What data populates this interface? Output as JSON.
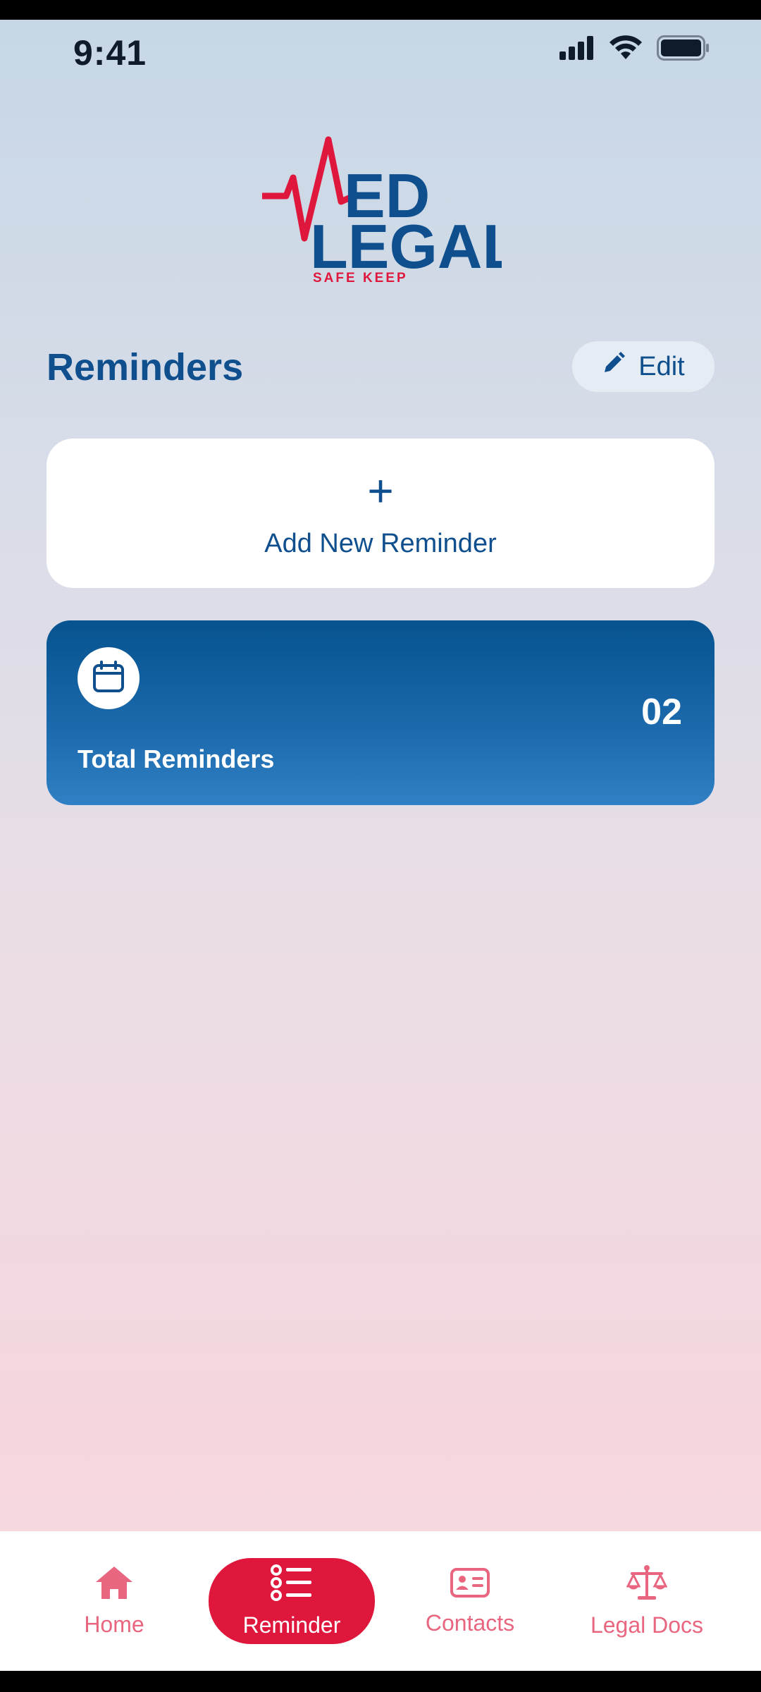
{
  "status_bar": {
    "time": "9:41"
  },
  "logo": {
    "line1": "ED",
    "line2": "LEGAL",
    "tagline": "SAFE KEEP"
  },
  "header": {
    "title": "Reminders",
    "edit_label": "Edit"
  },
  "add_card": {
    "plus": "+",
    "label": "Add New Reminder"
  },
  "total_card": {
    "label": "Total Reminders",
    "count": "02"
  },
  "nav": {
    "items": [
      {
        "label": "Home",
        "icon": "home-icon",
        "active": false
      },
      {
        "label": "Reminder",
        "icon": "list-icon",
        "active": true
      },
      {
        "label": "Contacts",
        "icon": "contact-card-icon",
        "active": false
      },
      {
        "label": "Legal Docs",
        "icon": "scales-icon",
        "active": false
      }
    ]
  },
  "colors": {
    "primary": "#0f4f8e",
    "accent": "#e0173c",
    "nav_inactive": "#e8667f",
    "card_blue": "#1b68ab"
  }
}
